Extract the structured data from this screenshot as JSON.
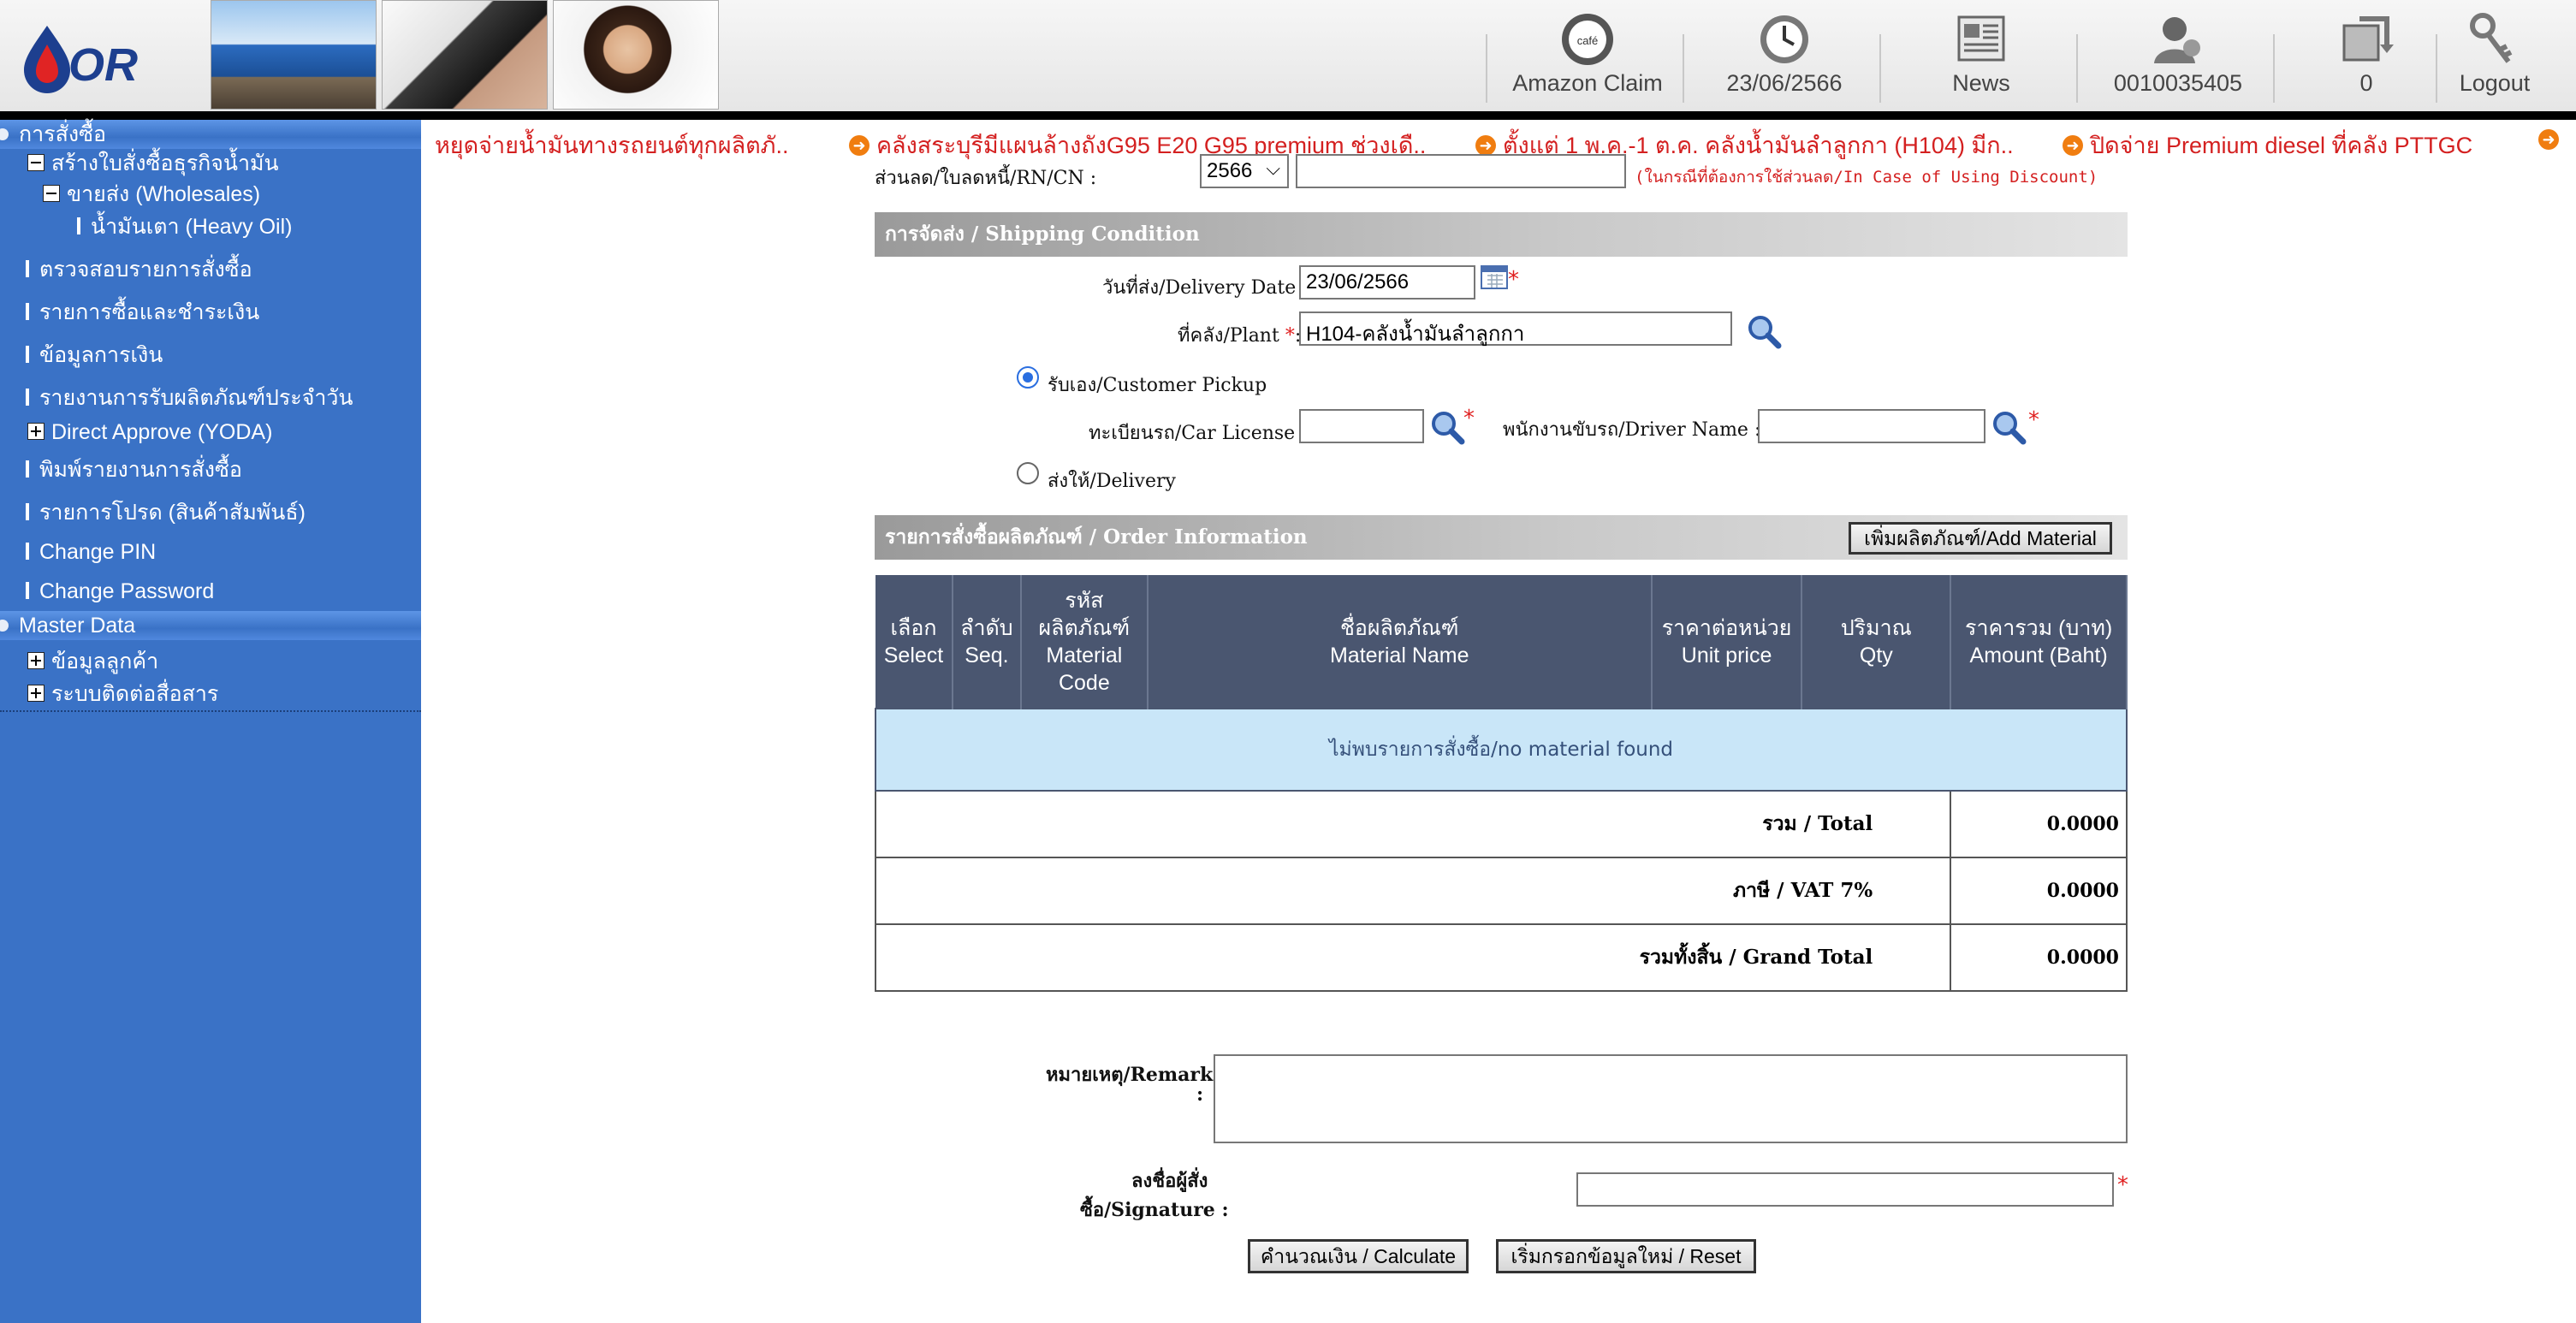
{
  "header": {
    "nav": [
      {
        "label": "Amazon Claim",
        "icon": "amazon-cafe-icon"
      },
      {
        "label": "23/06/2566",
        "icon": "clock-icon"
      },
      {
        "label": "News",
        "icon": "news-icon"
      },
      {
        "label": "0010035405",
        "icon": "user-icon"
      },
      {
        "label": "0",
        "icon": "refresh-icon"
      },
      {
        "label": "Logout",
        "icon": "keys-icon"
      }
    ]
  },
  "sidebar": {
    "order_section": "การสั่งซื้อ",
    "create_po": "สร้างใบสั่งซื้อธุรกิจน้ำมัน",
    "wholesales": "ขายส่ง (Wholesales)",
    "heavy_oil": "น้ำมันเตา (Heavy Oil)",
    "check_orders": "ตรวจสอบรายการสั่งซื้อ",
    "purchase_payment": "รายการซื้อและชำระเงิน",
    "finance_info": "ข้อมูลการเงิน",
    "daily_report": "รายงานการรับผลิตภัณฑ์ประจำวัน",
    "direct_approve": "Direct Approve (YODA)",
    "print_report": "พิมพ์รายงานการสั่งซื้อ",
    "promo": "รายการโปรด (สินค้าสัมพันธ์)",
    "change_pin": "Change PIN",
    "change_password": "Change Password",
    "master_section": "Master Data",
    "customer_info": "ข้อมูลลูกค้า",
    "communication": "ระบบติดต่อสื่อสาร"
  },
  "ticker": [
    "หยุดจ่ายน้ำมันทางรถยนต์ทุกผลิตภั..",
    "คลังสระบุรีมีแผนล้างถังG95 E20 G95 premium ช่วงเดื..",
    "ตั้งแต่ 1 พ.ค.-1 ต.ค. คลังน้ำมันลำลูกกา (H104) มีก..",
    "ปิดจ่าย Premium diesel ที่คลัง PTTGC"
  ],
  "discount": {
    "label": "ส่วนลด/ใบลดหนี้/RN/CN :",
    "year": "2566",
    "value": "",
    "note": "(ในกรณีที่ต้องการใช้ส่วนลด/In Case of Using Discount)"
  },
  "shipping": {
    "section_title": "การจัดส่ง  /  Shipping Condition",
    "delivery_date_label": "วันที่ส่ง/Delivery Date :",
    "delivery_date": "23/06/2566",
    "plant_label": "ที่คลัง/Plant",
    "plant_colon": ":",
    "plant_value": "H104-คลังน้ำมันลำลูกกา",
    "pickup_label": "รับเอง/Customer Pickup",
    "car_license_label": "ทะเบียนรถ/Car License :",
    "car_license": "",
    "driver_label": "พนักงานขับรถ/Driver Name :",
    "driver": "",
    "delivery_label": "ส่งให้/Delivery"
  },
  "order": {
    "section_title": "รายการสั่งซื้อผลิตภัณฑ์  /  Order Information",
    "add_button": "เพิ่มผลิตภัณฑ์/Add Material",
    "columns": [
      {
        "th": "เลือก",
        "en": "Select"
      },
      {
        "th": "ลำดับ",
        "en": "Seq."
      },
      {
        "th": "รหัส ผลิตภัณฑ์",
        "en": "Material Code"
      },
      {
        "th": "ชื่อผลิตภัณฑ์",
        "en": "Material Name"
      },
      {
        "th": "ราคาต่อหน่วย",
        "en": "Unit price"
      },
      {
        "th": "ปริมาณ",
        "en": "Qty"
      },
      {
        "th": "ราคารวม (บาท)",
        "en": "Amount (Baht)"
      }
    ],
    "empty_message": "ไม่พบรายการสั่งซื้อ/no material found",
    "total_label": "รวม / Total",
    "total": "0.0000",
    "vat_label": "ภาษี / VAT  7%",
    "vat": "0.0000",
    "grand_label": "รวมทั้งสิ้น / Grand Total",
    "grand": "0.0000"
  },
  "remarks": {
    "label_1": "หมายเหตุ/Remarks",
    "label_2": ":",
    "value": ""
  },
  "signature": {
    "label_1": "ลงชื่อผู้สั่ง",
    "label_2": "ซื้อ/Signature :",
    "value": ""
  },
  "actions": {
    "calculate": "คำนวณเงิน / Calculate",
    "reset": "เริ่มกรอกข้อมูลใหม่ / Reset"
  },
  "colors": {
    "sidebar": "#3a72c6",
    "ticker_text": "#d42020",
    "table_header": "#4a5670",
    "empty_row": "#c9e6f8"
  }
}
